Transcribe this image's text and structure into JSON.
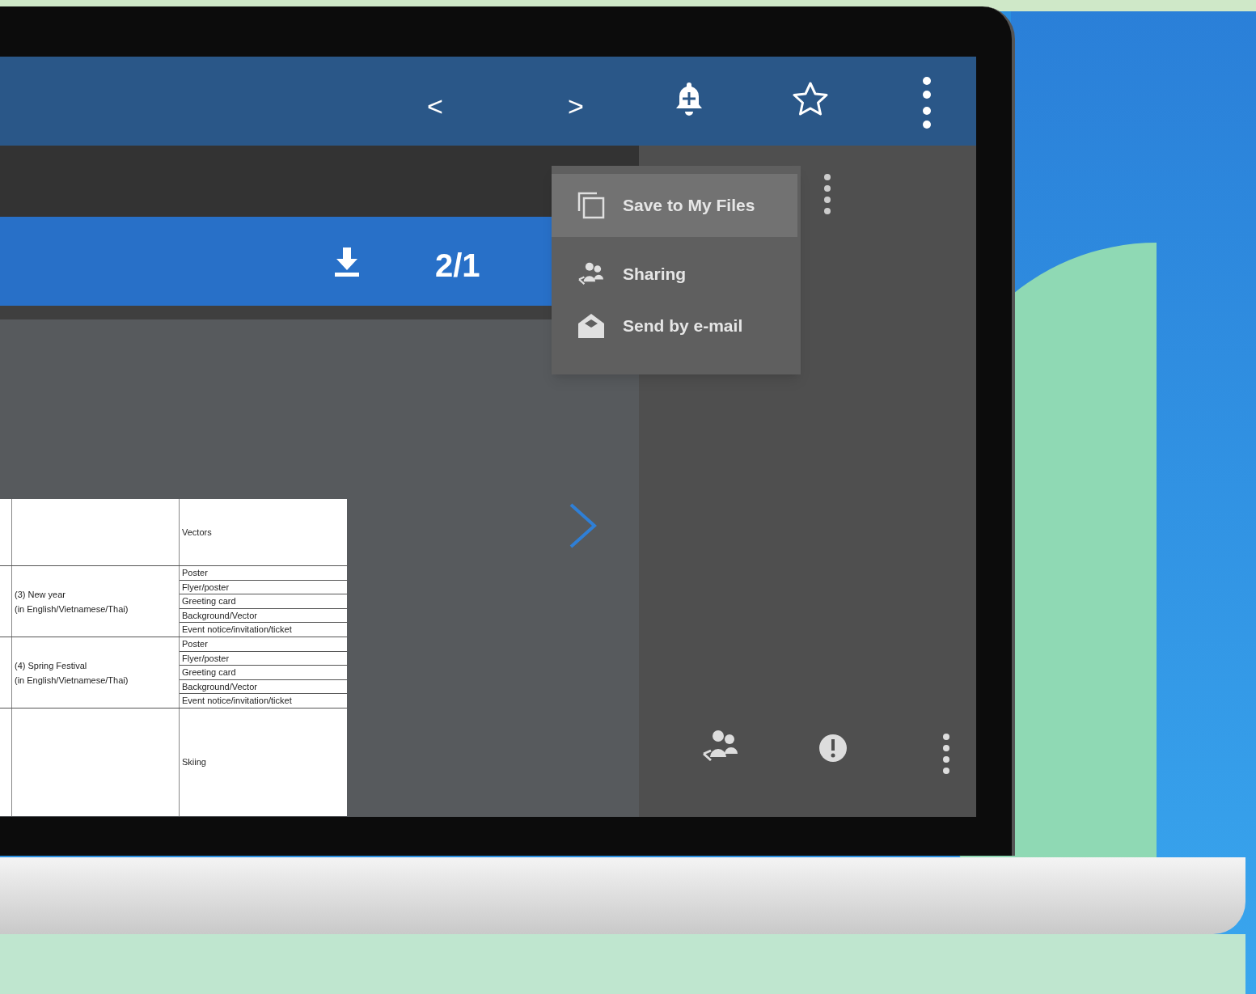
{
  "toolbar": {
    "previous": "<",
    "next": ">"
  },
  "document_bar": {
    "page": "2/1"
  },
  "menu": {
    "items": [
      {
        "label": "Save to My Files",
        "selected": true
      },
      {
        "label": "Sharing",
        "selected": false
      },
      {
        "label": "Send by e-mail",
        "selected": false
      }
    ]
  },
  "table": {
    "rows": [
      {
        "items": [
          "Vectors"
        ]
      },
      {
        "category": [
          "(3) New year",
          "(in English/Vietnamese/Thai)"
        ],
        "items": [
          "Poster",
          "Flyer/poster",
          "Greeting card",
          "Background/Vector",
          "Event notice/invitation/ticket"
        ]
      },
      {
        "category": [
          "(4) Spring Festival",
          "(in English/Vietnamese/Thai)"
        ],
        "items": [
          "Poster",
          "Flyer/poster",
          "Greeting card",
          "Background/Vector",
          "Event notice/invitation/ticket"
        ]
      },
      {
        "items": [
          "Skiing"
        ]
      }
    ]
  }
}
